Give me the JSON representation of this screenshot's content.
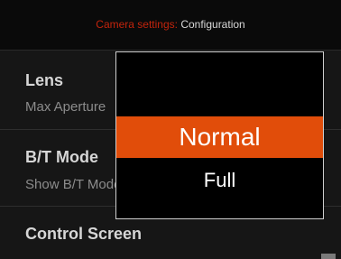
{
  "header": {
    "breadcrumb": "Camera settings:",
    "title": "Configuration"
  },
  "sections": {
    "lens": {
      "title": "Lens",
      "item": "Max Aperture"
    },
    "bt_mode": {
      "title": "B/T Mode",
      "item": "Show B/T Mode"
    },
    "control_screen": {
      "title": "Control Screen"
    }
  },
  "popup": {
    "options": [
      "Normal",
      "Full"
    ],
    "selected": "Normal"
  },
  "colors": {
    "accent": "#e14d0a",
    "breadcrumb": "#c2240c",
    "background": "#161616"
  }
}
